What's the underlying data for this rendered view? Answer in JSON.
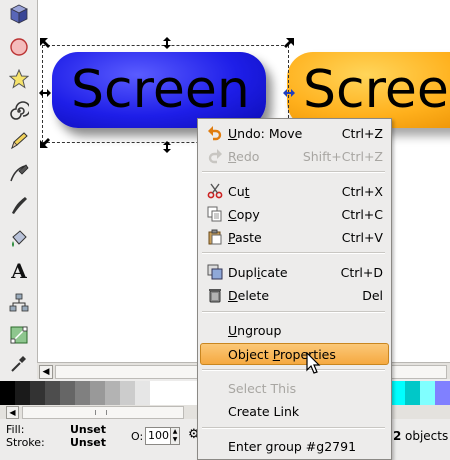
{
  "canvas": {
    "object1_text": "Screen",
    "object2_text": "Scree"
  },
  "toolbox": {
    "tools": [
      "3d-box-icon",
      "circle-icon",
      "star-icon",
      "spiral-icon",
      "pencil-icon",
      "pen-icon",
      "calligraphy-icon",
      "paint-bucket-icon",
      "text-icon",
      "connector-icon",
      "node-icon",
      "dropper-icon"
    ]
  },
  "palette": {
    "colors": [
      "#000000",
      "#1a1a1a",
      "#333333",
      "#4d4d4d",
      "#666666",
      "#808080",
      "#999999",
      "#b3b3b3",
      "#cccccc",
      "#e6e6e6",
      "#ffffff",
      "#ffffff",
      "#ffffff",
      "#ffffff",
      "#ffffff",
      "#ffffff",
      "#ffffff",
      "#ffffff",
      "#ffffff",
      "#ffffff",
      "#ffffff",
      "#ffffff",
      "#ffffff",
      "#00a0a0",
      "#00cccc",
      "#00e0e0",
      "#00ffff",
      "#00c8c8",
      "#80ffff",
      "#8080ff"
    ]
  },
  "status": {
    "fill_label": "Fill:",
    "fill_value": "Unset",
    "stroke_label": "Stroke:",
    "stroke_value": "Unset",
    "opacity_label": "O:",
    "opacity_value": "100",
    "objects_count": "2",
    "objects_text": "objects"
  },
  "context_menu": {
    "undo": {
      "label_pre": "",
      "label_u": "U",
      "label_post": "ndo: Move",
      "shortcut": "Ctrl+Z"
    },
    "redo": {
      "label_pre": "",
      "label_u": "R",
      "label_post": "edo",
      "shortcut": "Shift+Ctrl+Z"
    },
    "cut": {
      "label_pre": "Cu",
      "label_u": "t",
      "label_post": "",
      "shortcut": "Ctrl+X"
    },
    "copy": {
      "label_pre": "",
      "label_u": "C",
      "label_post": "opy",
      "shortcut": "Ctrl+C"
    },
    "paste": {
      "label_pre": "",
      "label_u": "P",
      "label_post": "aste",
      "shortcut": "Ctrl+V"
    },
    "duplicate": {
      "label_pre": "Dupl",
      "label_u": "i",
      "label_post": "cate",
      "shortcut": "Ctrl+D"
    },
    "delete": {
      "label_pre": "",
      "label_u": "D",
      "label_post": "elete",
      "shortcut": "Del"
    },
    "ungroup": {
      "label_pre": "",
      "label_u": "U",
      "label_post": "ngroup"
    },
    "object_properties": {
      "label_pre": "Object ",
      "label_u": "P",
      "label_post": "roperties"
    },
    "select_this": {
      "label": "Select This"
    },
    "create_link": {
      "label": "Create Link"
    },
    "enter_group": {
      "label": "Enter group #g2791"
    }
  }
}
